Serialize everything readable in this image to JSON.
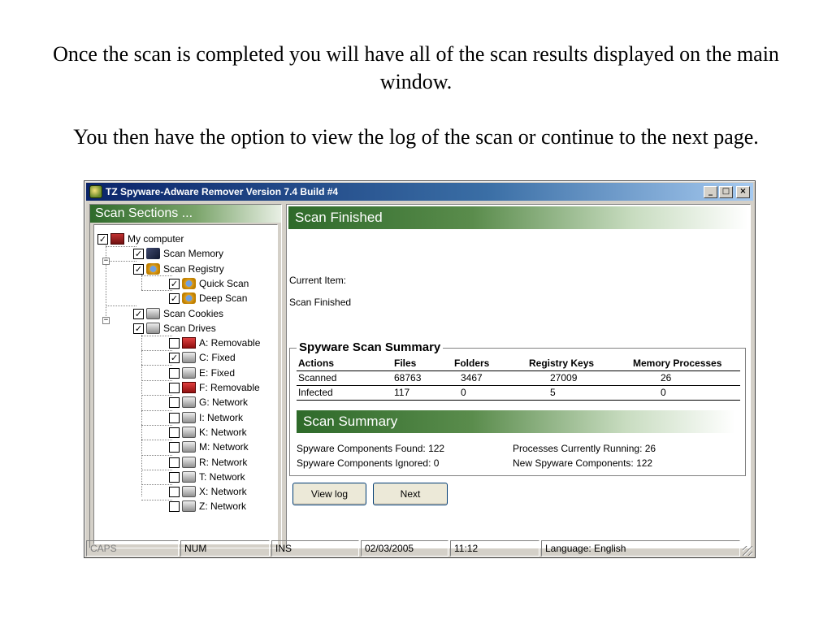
{
  "caption": {
    "line1": "Once the scan is completed you will have all of the scan results displayed on the main window.",
    "line2": "You then have the option to view the log of the scan or continue to the next page."
  },
  "window": {
    "title": "TZ Spyware-Adware Remover Version 7.4 Build #4",
    "minimize_label": "_",
    "maximize_label": "□",
    "close_label": "×"
  },
  "left": {
    "header": "Scan Sections ...",
    "tree": [
      {
        "label": "My computer",
        "checked": true,
        "icon": "computer-icon"
      },
      {
        "label": "Scan Memory",
        "checked": true,
        "icon": "memory-icon"
      },
      {
        "label": "Scan Registry",
        "checked": true,
        "icon": "registry-icon"
      },
      {
        "label": "Quick Scan",
        "checked": true,
        "icon": "registry-icon"
      },
      {
        "label": "Deep Scan",
        "checked": true,
        "icon": "registry-icon"
      },
      {
        "label": "Scan Cookies",
        "checked": true,
        "icon": "drive-icon"
      },
      {
        "label": "Scan Drives",
        "checked": true,
        "icon": "drive-icon"
      },
      {
        "label": "A: Removable",
        "checked": false,
        "icon": "removable-drive-icon"
      },
      {
        "label": "C: Fixed",
        "checked": true,
        "icon": "drive-icon"
      },
      {
        "label": "E: Fixed",
        "checked": false,
        "icon": "drive-icon"
      },
      {
        "label": "F: Removable",
        "checked": false,
        "icon": "removable-drive-icon"
      },
      {
        "label": "G: Network",
        "checked": false,
        "icon": "drive-icon"
      },
      {
        "label": "I: Network",
        "checked": false,
        "icon": "drive-icon"
      },
      {
        "label": "K: Network",
        "checked": false,
        "icon": "drive-icon"
      },
      {
        "label": "M: Network",
        "checked": false,
        "icon": "drive-icon"
      },
      {
        "label": "R: Network",
        "checked": false,
        "icon": "drive-icon"
      },
      {
        "label": "T: Network",
        "checked": false,
        "icon": "drive-icon"
      },
      {
        "label": "X: Network",
        "checked": false,
        "icon": "drive-icon"
      },
      {
        "label": "Z: Network",
        "checked": false,
        "icon": "drive-icon"
      }
    ]
  },
  "main": {
    "header": "Scan Finished",
    "current_item_label": "Current Item:",
    "current_item_value": "Scan Finished",
    "summary_group_title": "Spyware Scan Summary",
    "table": {
      "columns": [
        "Actions",
        "Files",
        "Folders",
        "Registry Keys",
        "Memory Processes"
      ],
      "rows": [
        [
          "Scanned",
          "68763",
          "3467",
          "27009",
          "26"
        ],
        [
          "Infected",
          "117",
          "0",
          "5",
          "0"
        ]
      ]
    },
    "scan_summary_header": "Scan Summary",
    "stats": {
      "components_found": "Spyware Components Found: 122",
      "components_ignored": "Spyware Components Ignored: 0",
      "processes_running": "Processes Currently Running: 26",
      "new_components": "New Spyware Components: 122"
    },
    "view_log_label": "View log",
    "next_label": "Next"
  },
  "statusbar": {
    "caps": "CAPS",
    "num": "NUM",
    "ins": "INS",
    "date": "02/03/2005",
    "time": "11:12",
    "language": "Language: English"
  },
  "colors": {
    "header_green": "#2e6a2a",
    "titlebar_blue": "#0a246a",
    "window_gray": "#d4d0c8"
  }
}
